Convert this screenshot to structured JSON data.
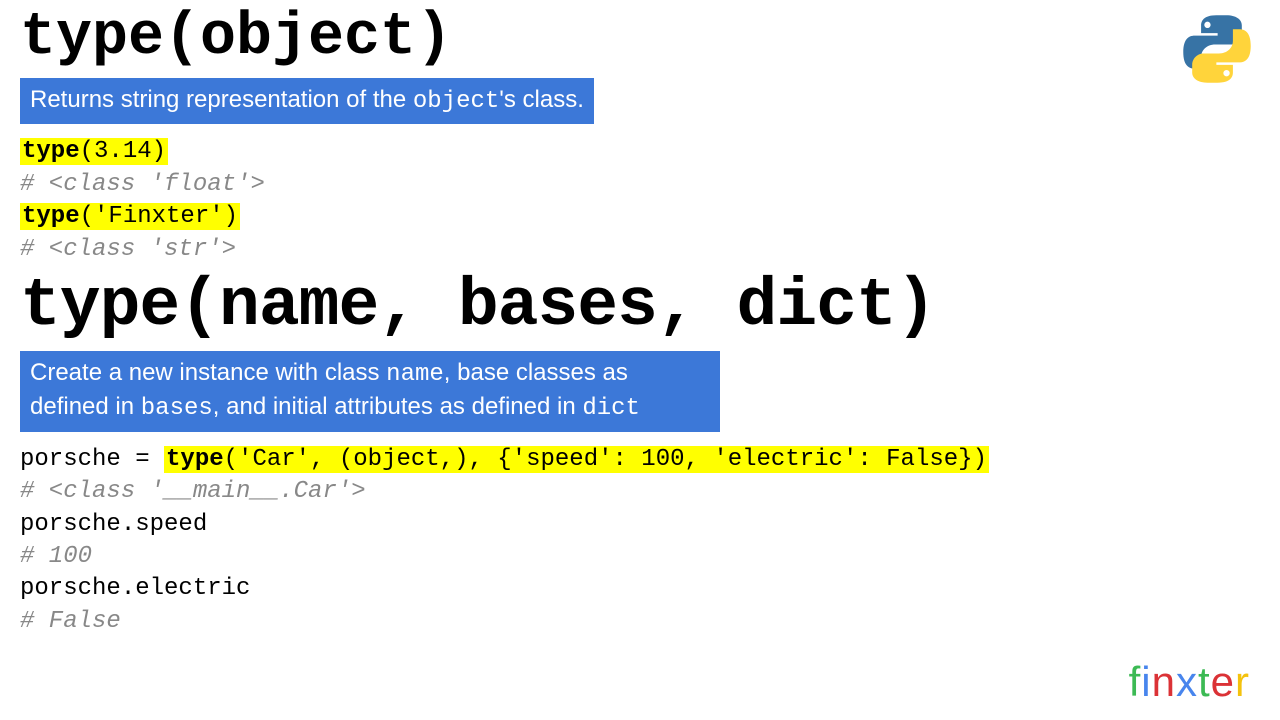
{
  "section1": {
    "title": "type(object)",
    "desc_pre": "Returns string representation of the ",
    "desc_code": "object",
    "desc_post": "'s class.",
    "code": {
      "hl1_func": "type",
      "rest1": "(3.14)",
      "comment1": "# <class 'float'>",
      "hl2_func": "type",
      "rest2": "('Finxter')",
      "comment2": "# <class 'str'>"
    }
  },
  "section2": {
    "title": "type(name, bases, dict)",
    "desc_pre": "Create a new instance with class ",
    "desc_c1": "name",
    "desc_mid1": ", base classes as defined in ",
    "desc_c2": "bases",
    "desc_mid2": ", and initial attributes as defined in ",
    "desc_c3": "dict",
    "code": {
      "pre1": "porsche = ",
      "hl1_func": "type",
      "rest1": "('Car', (object,), {'speed': 100, 'electric': False})",
      "comment1": "# <class '__main__.Car'>",
      "line2": "porsche.speed",
      "comment2": "# 100",
      "line3": "porsche.electric",
      "comment3": "# False"
    }
  },
  "logo": {
    "f": "f",
    "i": "i",
    "n": "n",
    "x": "x",
    "t": "t",
    "e": "e",
    "r": "r"
  }
}
